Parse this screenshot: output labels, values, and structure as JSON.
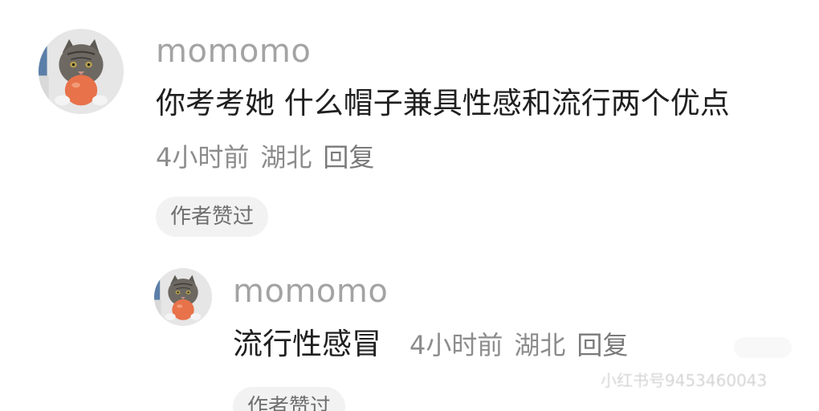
{
  "comment": {
    "username": "momomo",
    "text": "你考考她 什么帽子兼具性感和流行两个优点",
    "meta": {
      "time": "4小时前",
      "location": "湖北",
      "reply": "回复"
    },
    "badge": "作者赞过",
    "avatar_icon": "cat-avatar-icon"
  },
  "reply": {
    "username": "momomo",
    "text": "流行性感冒",
    "meta": {
      "time": "4小时前",
      "location": "湖北",
      "reply": "回复"
    },
    "badge": "作者赞过",
    "avatar_icon": "cat-avatar-icon"
  },
  "watermark": {
    "text": "小红书号9453460043"
  }
}
